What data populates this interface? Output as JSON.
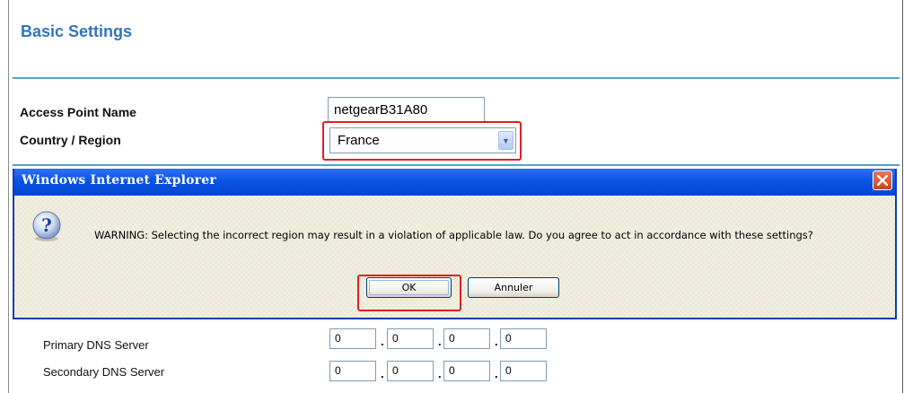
{
  "page": {
    "title": "Basic Settings"
  },
  "access_point": {
    "label": "Access Point Name",
    "value": "netgearB31A80"
  },
  "country": {
    "label": "Country / Region",
    "value": "France"
  },
  "dialog": {
    "title": "Windows Internet Explorer",
    "message": "WARNING: Selecting the incorrect region may result in a violation of applicable law. Do you agree to act in accordance with these settings?",
    "ok_label": "OK",
    "cancel_label": "Annuler",
    "icon": "question-icon"
  },
  "dns": {
    "primary": {
      "label": "Primary DNS Server",
      "octets": [
        "0",
        "0",
        "0",
        "0"
      ]
    },
    "secondary": {
      "label": "Secondary DNS Server",
      "octets": [
        "0",
        "0",
        "0",
        "0"
      ]
    },
    "separator": "."
  },
  "colors": {
    "heading": "#3275b9",
    "rule": "#51a3d4",
    "highlight": "#e02020",
    "titlebar": "#0953e3",
    "dialog_bg": "#ece9d8"
  }
}
